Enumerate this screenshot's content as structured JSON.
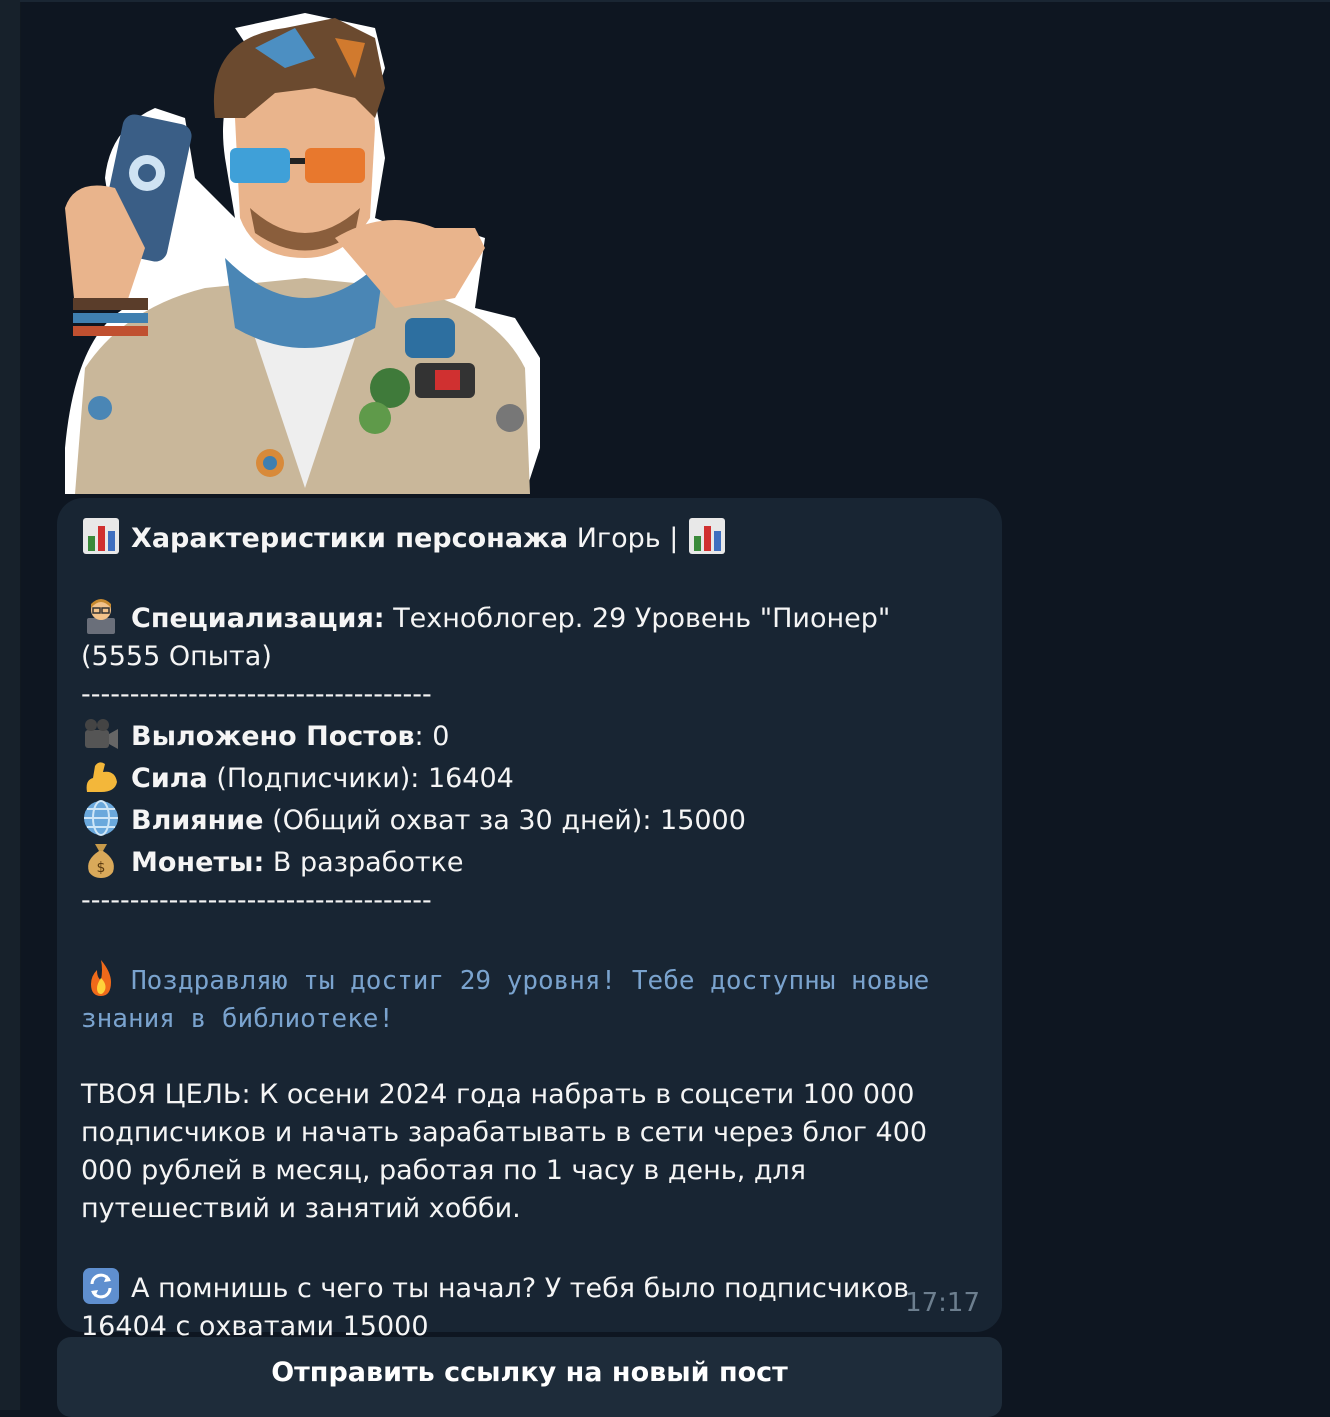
{
  "message": {
    "header": {
      "title_bold": "Характеристики персонажа",
      "title_rest": " Игорь | "
    },
    "specialization": {
      "label": "Специализация:",
      "value": " Техноблогер. 29 Уровень \"Пионер\" (5555 Опыта)"
    },
    "separator": "------------------------------------",
    "stats": [
      {
        "icon": "movie-camera-icon",
        "label": "Выложено Постов",
        "value": ": 0"
      },
      {
        "icon": "flexed-biceps-icon",
        "label": "Сила",
        "value": " (Подписчики): 16404"
      },
      {
        "icon": "globe-icon",
        "label": "Влияние",
        "value": " (Общий охват за 30 дней): 15000"
      },
      {
        "icon": "money-bag-icon",
        "label": "Монеты:",
        "value": " В разработке"
      }
    ],
    "congrats": "Поздравляю ты достиг 29 уровня! Тебе доступны новые знания в библиотеке!",
    "goal": "ТВОЯ ЦЕЛЬ: К осени 2024 года набрать в соцсети 100 000 подписчиков и начать зарабатывать в сети через блог 400 000 рублей в месяц, работая по 1 часу в день, для путешествий и занятий хобби.",
    "reminder": "А помнишь с чего ты начал? У тебя было подписчиков 16404 с охватами 15000",
    "time": "17:17"
  },
  "inline_button": {
    "label": "Отправить ссылку на новый пост"
  },
  "colors": {
    "background": "#0e1621",
    "bubble": "#182533",
    "mono_text": "#7aa3ce",
    "time": "#6d7f8f",
    "button": "#1e2c3a"
  }
}
